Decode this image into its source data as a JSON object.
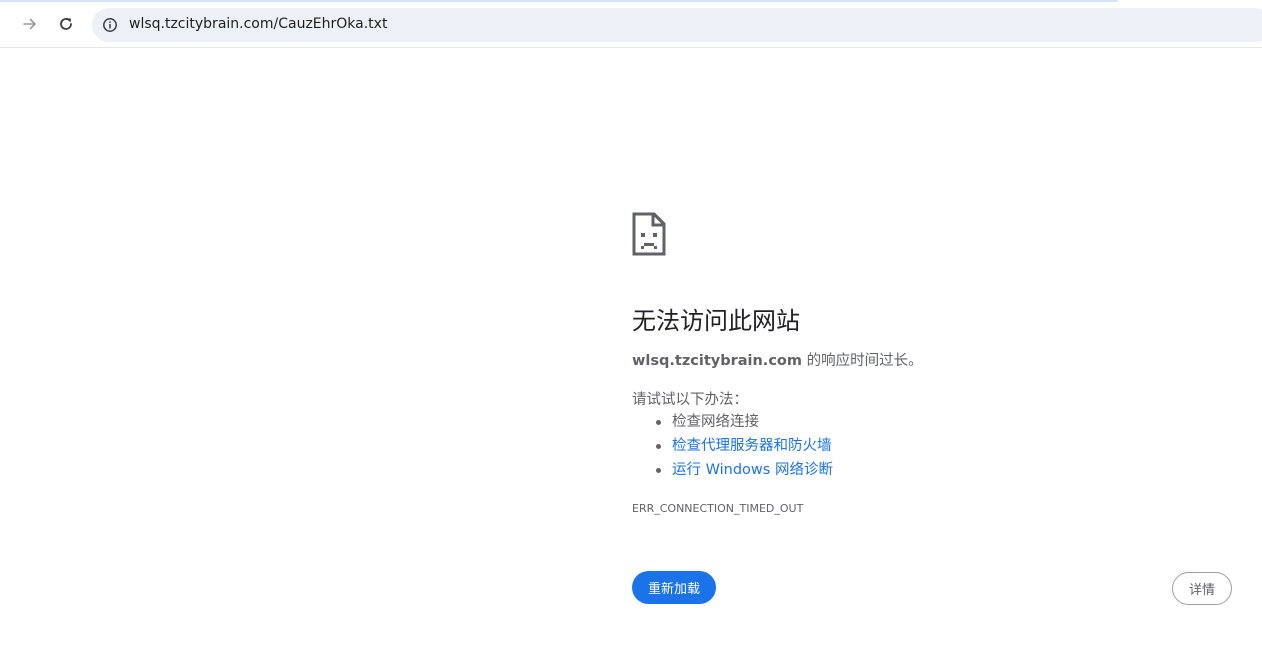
{
  "browser": {
    "url": "wlsq.tzcitybrain.com/CauzEhrOka.txt",
    "icons": {
      "forward": "arrow-right-icon",
      "reload": "reload-icon",
      "site_info": "info-icon"
    }
  },
  "error_page": {
    "heading": "无法访问此网站",
    "host": "wlsq.tzcitybrain.com",
    "summary_suffix": " 的响应时间过长。",
    "try_label": "请试试以下办法：",
    "suggestions": [
      {
        "label": "检查网络连接",
        "link": false
      },
      {
        "label": "检查代理服务器和防火墙",
        "link": true
      },
      {
        "label": "运行 Windows 网络诊断",
        "link": true
      }
    ],
    "error_code": "ERR_CONNECTION_TIMED_OUT",
    "reload_label": "重新加载",
    "details_label": "详情",
    "icon": "sad-page-icon"
  },
  "colors": {
    "accent": "#1a73e8",
    "omnibox_bg": "#edf0f7",
    "text_secondary": "#5f6368"
  }
}
